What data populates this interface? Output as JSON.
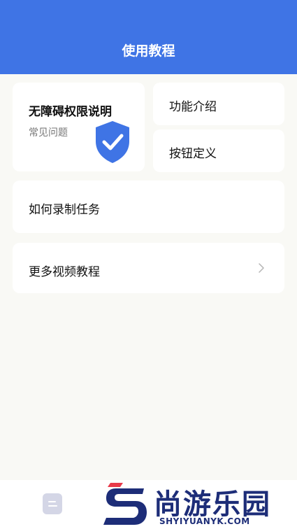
{
  "header": {
    "title": "使用教程"
  },
  "colors": {
    "accent": "#3f74e5",
    "background": "#f9f9f5",
    "card": "#ffffff",
    "shield": "#3f74e5"
  },
  "cards": {
    "accessibility": {
      "title": "无障碍权限说明",
      "subtitle": "常见问题",
      "icon": "shield-check-icon"
    },
    "feature_intro": {
      "label": "功能介绍"
    },
    "button_definition": {
      "label": "按钮定义"
    },
    "record_task": {
      "label": "如何录制任务"
    },
    "more_videos": {
      "label": "更多视频教程",
      "icon": "chevron-right-icon"
    }
  },
  "bottom_bar": {
    "icon": "document-icon"
  },
  "watermark": {
    "text": "尚游乐园",
    "url": "SHYIYUANYK.COM"
  }
}
